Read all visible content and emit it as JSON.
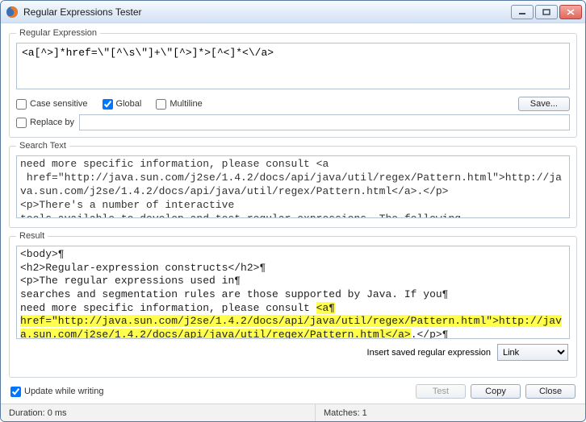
{
  "window": {
    "title": "Regular Expressions Tester"
  },
  "regex_section": {
    "legend": "Regular Expression",
    "value": "<a[^>]*href=\\\"[^\\s\\\"]+\\\"[^>]*>[^<]*<\\/a>",
    "case_label": "Case sensitive",
    "case_checked": false,
    "global_label": "Global",
    "global_checked": true,
    "multiline_label": "Multiline",
    "multiline_checked": false,
    "save_label": "Save...",
    "replace_label": "Replace by",
    "replace_checked": false,
    "replace_value": ""
  },
  "search_section": {
    "legend": "Search Text",
    "text": "need more specific information, please consult <a\n href=\"http://java.sun.com/j2se/1.4.2/docs/api/java/util/regex/Pattern.html\">http://java.sun.com/j2se/1.4.2/docs/api/java/util/regex/Pattern.html</a>.</p>\n<p>There's a number of interactive\ntools available to develop and test regular expressions. The following"
  },
  "result_section": {
    "legend": "Result",
    "pre1": "<body>¶\n<h2>Regular-expression constructs</h2>¶\n<p>The regular expressions used in¶\nsearches and segmentation rules are those supported by Java. If you¶\nneed more specific information, please consult ",
    "match": "<a¶\nhref=\"http://java.sun.com/j2se/1.4.2/docs/api/java/util/regex/Pattern.html\">http://java.sun.com/j2se/1.4.2/docs/api/java/util/regex/Pattern.html</a>",
    "post1": ".</p>¶\n<p>There's a number of interactive¶"
  },
  "bottom": {
    "insert_label": "Insert saved regular expression",
    "select_value": "Link",
    "update_label": "Update while writing",
    "update_checked": true,
    "test_label": "Test",
    "copy_label": "Copy",
    "close_label": "Close"
  },
  "status": {
    "duration": "Duration: 0 ms",
    "matches": "Matches: 1"
  }
}
